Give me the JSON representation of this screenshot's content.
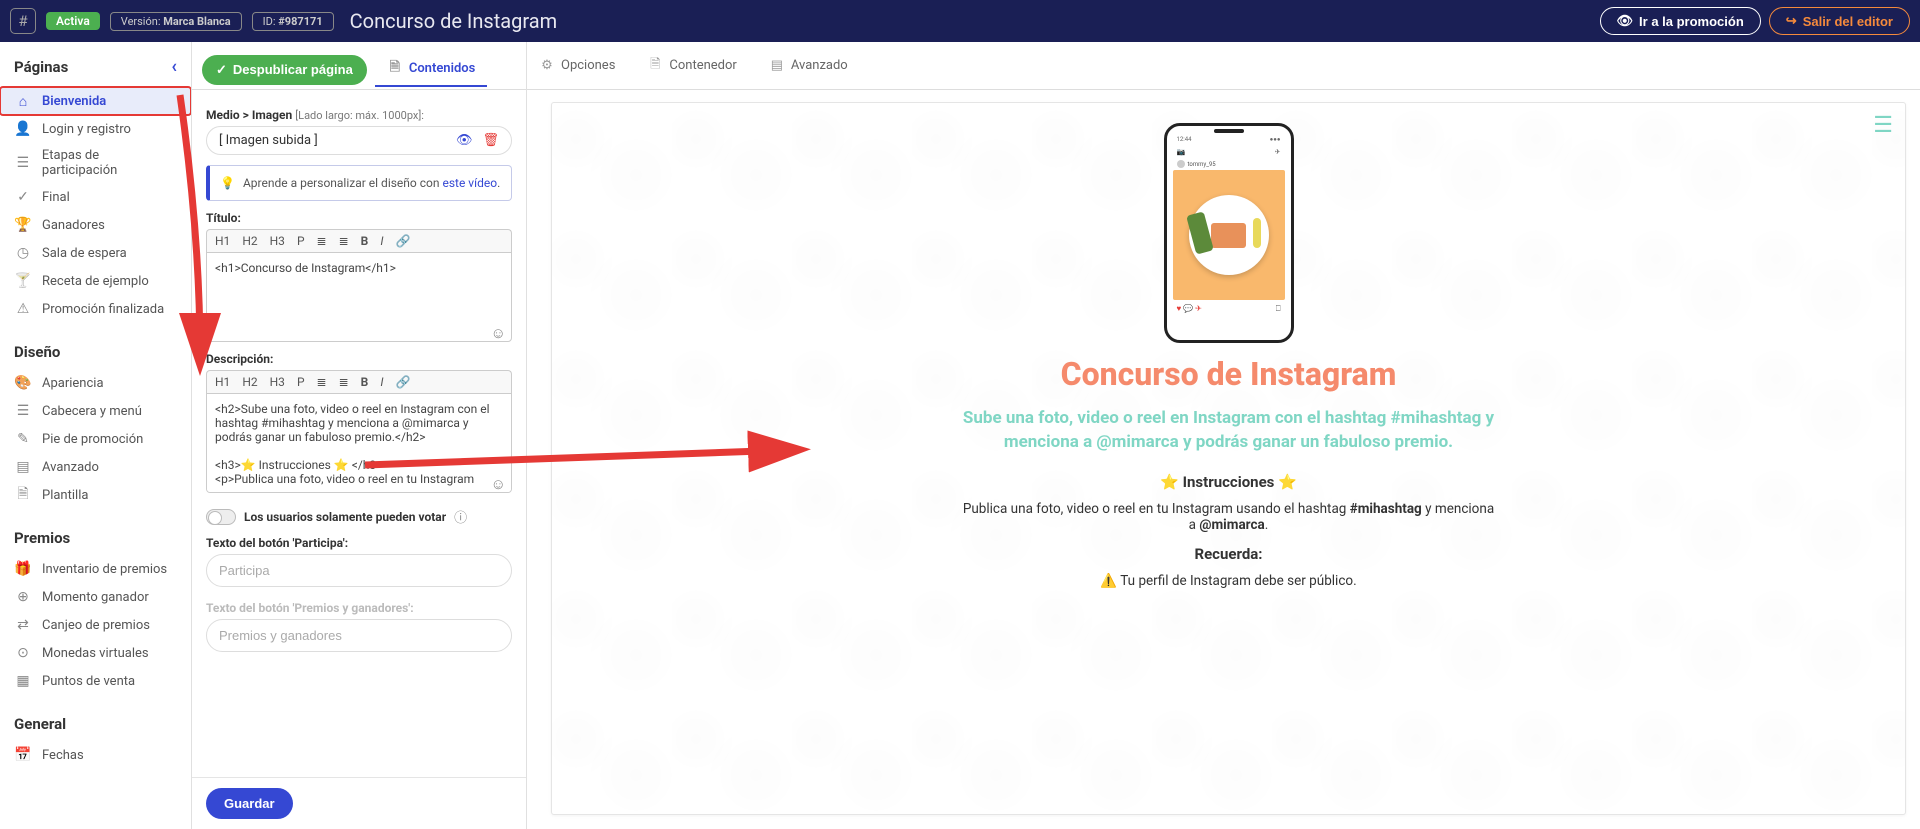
{
  "topbar": {
    "status": "Activa",
    "version_label": "Versión:",
    "version_value": "Marca Blanca",
    "id_label": "ID:",
    "id_value": "#987171",
    "title": "Concurso de Instagram",
    "goto_promo": "Ir a la promoción",
    "exit": "Salir del editor"
  },
  "sidebar": {
    "pages_header": "Páginas",
    "items_pages": [
      {
        "icon": "⌂",
        "label": "Bienvenida",
        "active": true
      },
      {
        "icon": "👤",
        "label": "Login y registro"
      },
      {
        "icon": "☰",
        "label": "Etapas de participación"
      },
      {
        "icon": "✓",
        "label": "Final"
      },
      {
        "icon": "🏆",
        "label": "Ganadores"
      },
      {
        "icon": "◷",
        "label": "Sala de espera"
      },
      {
        "icon": "🍸",
        "label": "Receta de ejemplo"
      },
      {
        "icon": "⚠",
        "label": "Promoción finalizada"
      }
    ],
    "design_header": "Diseño",
    "items_design": [
      {
        "icon": "🎨",
        "label": "Apariencia"
      },
      {
        "icon": "☰",
        "label": "Cabecera y menú"
      },
      {
        "icon": "✎",
        "label": "Pie de promoción"
      },
      {
        "icon": "▤",
        "label": "Avanzado"
      },
      {
        "icon": "🗎",
        "label": "Plantilla"
      }
    ],
    "prizes_header": "Premios",
    "items_prizes": [
      {
        "icon": "🎁",
        "label": "Inventario de premios"
      },
      {
        "icon": "⊕",
        "label": "Momento ganador"
      },
      {
        "icon": "⇄",
        "label": "Canjeo de premios"
      },
      {
        "icon": "⊙",
        "label": "Monedas virtuales"
      },
      {
        "icon": "▦",
        "label": "Puntos de venta"
      }
    ],
    "general_header": "General",
    "items_general": [
      {
        "icon": "📅",
        "label": "Fechas"
      }
    ]
  },
  "tabs": {
    "publish": "Despublicar página",
    "items": [
      {
        "icon": "🗎",
        "label": "Contenidos",
        "active": true
      },
      {
        "icon": "⚙",
        "label": "Opciones"
      },
      {
        "icon": "🗎",
        "label": "Contenedor"
      },
      {
        "icon": "▤",
        "label": "Avanzado"
      }
    ]
  },
  "editor": {
    "media_label": "Medio > Imagen",
    "media_meta": "[Lado largo: máx. 1000px]:",
    "media_value": "[ Imagen subida ]",
    "hint_pre": "Aprende a personalizar el diseño con ",
    "hint_link": "este vídeo",
    "title_label": "Título:",
    "title_value": "<h1>Concurso de Instagram</h1>",
    "desc_label": "Descripción:",
    "desc_value": "<h2>Sube una foto, video o reel en Instagram con el hashtag #mihashtag y menciona a @mimarca y podrás ganar un fabuloso premio.</h2>\n\n<h3>⭐ Instrucciones ⭐ </h3>\n<p>Publica una foto, video o reel en tu Instagram",
    "vote_label": "Los usuarios solamente pueden votar",
    "btn1_label": "Texto del botón 'Participa':",
    "btn1_placeholder": "Participa",
    "btn2_label": "Texto del botón 'Premios y ganadores':",
    "btn2_placeholder": "Premios y ganadores",
    "save": "Guardar",
    "toolbar": [
      "H1",
      "H2",
      "H3",
      "P",
      "≣",
      "≣",
      "B",
      "I",
      "🔗"
    ]
  },
  "preview": {
    "title": "Concurso de Instagram",
    "subtitle": "Sube una foto, video o reel en Instagram con el hashtag #mihashtag y menciona a @mimarca y podrás ganar un fabuloso premio.",
    "instructions_h": "⭐ Instrucciones ⭐",
    "instructions_p_pre": "Publica una foto, video o reel en tu Instagram usando el hashtag ",
    "instructions_p_b1": "#mihashtag",
    "instructions_p_mid": " y menciona a ",
    "instructions_p_b2": "@mimarca",
    "remember_h": "Recuerda:",
    "remember_p": "⚠️ Tu perfil de Instagram debe ser público.",
    "phone_time": "12:44",
    "phone_user": "tommy_95"
  }
}
